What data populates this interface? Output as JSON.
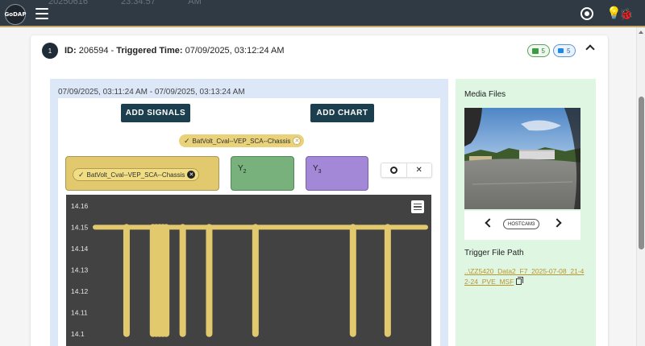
{
  "app": {
    "logo_text": "GoDAP",
    "ghost_row": [
      "20250616",
      "23:34:57",
      "AM"
    ]
  },
  "card": {
    "number": "1",
    "id_label": "ID:",
    "id_value": "206594",
    "separator": " - ",
    "trigger_label": "Triggered Time:",
    "trigger_value": "07/09/2025, 03:12:24 AM",
    "image_count": "5",
    "video_count": "5"
  },
  "chart_panel": {
    "time_range": "07/09/2025, 03:11:24 AM - 07/09/2025, 03:13:24 AM",
    "add_signals_label": "ADD SIGNALS",
    "add_chart_label": "ADD CHART",
    "signal_chip": "BatVolt_Cval--VEP_SCA--Chassis",
    "y_axes": [
      {
        "name": "Y",
        "sub": "1",
        "signal": "BatVolt_Cval--VEP_SCA--Chassis",
        "color": "#e2c96d"
      },
      {
        "name": "Y",
        "sub": "2",
        "color": "#78b17b"
      },
      {
        "name": "Y",
        "sub": "3",
        "color": "#a488d8"
      }
    ]
  },
  "chart_data": {
    "type": "line",
    "series": [
      {
        "name": "BatVolt_Cval--VEP_SCA--Chassis",
        "color": "#e2c96d",
        "baseline": 14.15,
        "dips": [
          {
            "x": 0.095,
            "y": 14.1
          },
          {
            "x": 0.175,
            "y": 14.1
          },
          {
            "x": 0.185,
            "y": 14.1
          },
          {
            "x": 0.195,
            "y": 14.1
          },
          {
            "x": 0.205,
            "y": 14.1
          },
          {
            "x": 0.215,
            "y": 14.1
          },
          {
            "x": 0.265,
            "y": 14.1
          },
          {
            "x": 0.345,
            "y": 14.1
          },
          {
            "x": 0.485,
            "y": 14.1
          },
          {
            "x": 0.78,
            "y": 14.1
          },
          {
            "x": 0.885,
            "y": 14.1
          }
        ]
      }
    ],
    "y_ticks": [
      "14.16",
      "14.15",
      "14.14",
      "14.13",
      "14.12",
      "14.11",
      "14.1"
    ],
    "ylim": [
      14.095,
      14.163
    ],
    "x_range": [
      0,
      1
    ],
    "grid": false,
    "background": "#424242"
  },
  "media": {
    "title": "Media Files",
    "camera_label": "HOSTCAM3",
    "trigger_title": "Trigger File Path",
    "trigger_path": "..\\ZZ5420_Data2_F7_2025-07-08_21-42-24_PVE_MSF"
  }
}
